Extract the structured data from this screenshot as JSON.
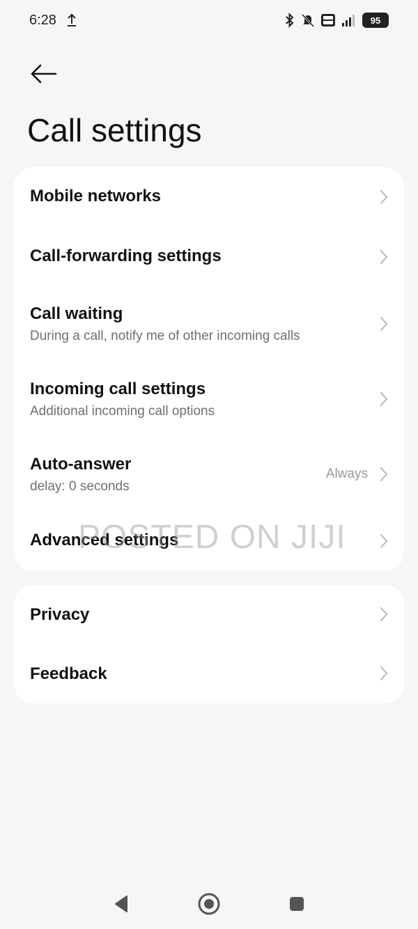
{
  "status_bar": {
    "time": "6:28",
    "battery": "95",
    "icons": [
      "upload-icon",
      "bluetooth-icon",
      "silent-icon",
      "volte-icon",
      "signal-icon",
      "battery-icon"
    ]
  },
  "header": {
    "back_icon": "arrow-left-icon",
    "title": "Call settings"
  },
  "sections": [
    {
      "items": [
        {
          "title": "Mobile networks",
          "subtitle": "",
          "value": ""
        },
        {
          "title": "Call-forwarding settings",
          "subtitle": "",
          "value": ""
        },
        {
          "title": "Call waiting",
          "subtitle": "During a call, notify me of other incoming calls",
          "value": ""
        },
        {
          "title": "Incoming call settings",
          "subtitle": "Additional incoming call options",
          "value": ""
        },
        {
          "title": "Auto-answer",
          "subtitle": "delay: 0 seconds",
          "value": "Always"
        },
        {
          "title": "Advanced settings",
          "subtitle": "",
          "value": ""
        }
      ]
    },
    {
      "items": [
        {
          "title": "Privacy",
          "subtitle": "",
          "value": ""
        },
        {
          "title": "Feedback",
          "subtitle": "",
          "value": ""
        }
      ]
    }
  ],
  "watermark": "POSTED ON JIJI",
  "nav": {
    "icons": [
      "nav-back-icon",
      "nav-home-icon",
      "nav-recents-icon"
    ]
  },
  "colors": {
    "background": "#f6f6f6",
    "card": "#ffffff",
    "title": "#121212",
    "subtitle": "#6f6f6f",
    "chevron": "#b8b8b8"
  }
}
